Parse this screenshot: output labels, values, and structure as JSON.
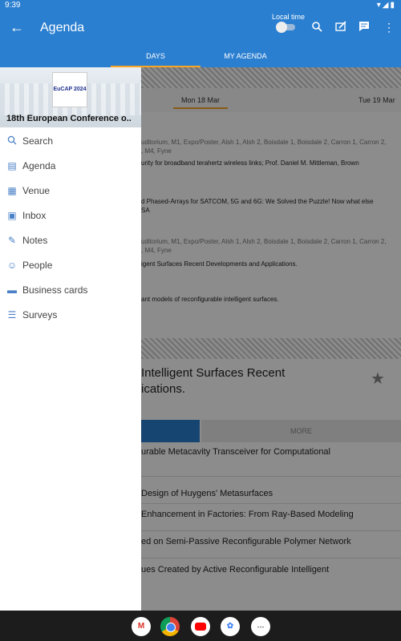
{
  "status": {
    "time": "9:39",
    "left_icons": "✉ ◉",
    "right_icons": "▾◢▮"
  },
  "appbar": {
    "title": "Agenda",
    "local_time_label": "Local time"
  },
  "tabs": [
    "DAYS",
    "MY AGENDA"
  ],
  "days": {
    "selected": "Mon 18 Mar",
    "next": "Tue 19 Mar"
  },
  "sessions": [
    {
      "rooms": "uditorium, M1, Expo/Poster, Alsh 1, Alsh 2, Boisdale 1, Boisdale 2, Carron 1, Carron 2,",
      "rooms2": ", M4, Fyne",
      "title": "urity for broadband terahertz wireless links; Prof. Daniel M. Mittleman, Brown"
    },
    {
      "title": "d Phased-Arrays for SATCOM, 5G and 6G: We Solved the Puzzle! Now what else",
      "title2": "SA"
    },
    {
      "rooms": "uditorium, M1, Expo/Poster, Alsh 1, Alsh 2, Boisdale 1, Boisdale 2, Carron 1, Carron 2,",
      "rooms2": ", M4, Fyne",
      "title": "igent Surfaces Recent Developments and Applications."
    },
    {
      "title": "ant models of reconfigurable intelligent surfaces."
    }
  ],
  "detail": {
    "title_line1": "Intelligent Surfaces Recent",
    "title_line2": "ications.",
    "more_label": "MORE",
    "papers": [
      "urable Metacavity Transceiver for Computational",
      "Design of Huygens' Metasurfaces",
      "Enhancement in Factories: From Ray-Based Modeling",
      "ed on Semi-Passive Reconfigurable Polymer Network",
      "ues Created by Active Reconfigurable Intelligent"
    ]
  },
  "drawer": {
    "conference_title": "18th European Conference o..",
    "logo_text": "EuCAP 2024",
    "menu": [
      {
        "label": "Search",
        "icon": "search-icon"
      },
      {
        "label": "Agenda",
        "icon": "agenda-icon"
      },
      {
        "label": "Venue",
        "icon": "venue-icon"
      },
      {
        "label": "Inbox",
        "icon": "inbox-icon"
      },
      {
        "label": "Notes",
        "icon": "notes-icon"
      },
      {
        "label": "People",
        "icon": "people-icon"
      },
      {
        "label": "Business cards",
        "icon": "business-card-icon"
      },
      {
        "label": "Surveys",
        "icon": "surveys-icon"
      }
    ]
  },
  "colors": {
    "primary": "#2b7fd0",
    "accent": "#f6a623",
    "icon": "#4a80c7"
  }
}
